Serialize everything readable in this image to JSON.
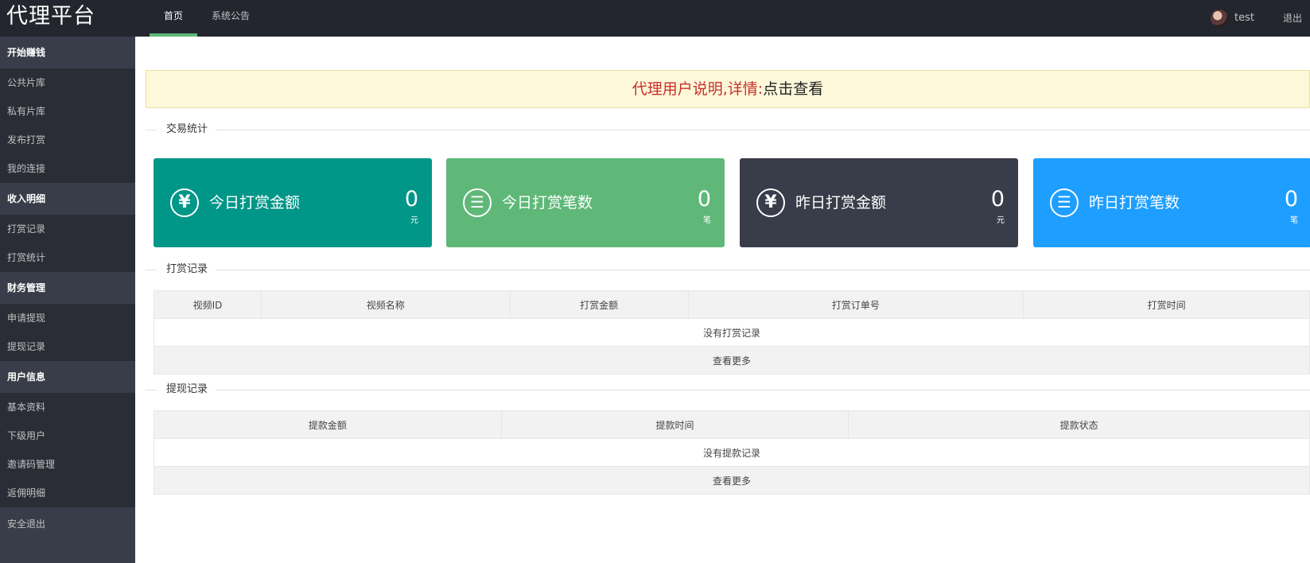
{
  "header": {
    "logo": "代理平台",
    "nav": [
      {
        "label": "首页",
        "active": true
      },
      {
        "label": "系统公告",
        "active": false
      }
    ],
    "user": "test",
    "logout": "退出"
  },
  "sidebar": {
    "groups": [
      {
        "title": "开始赚钱",
        "items": [
          "公共片库",
          "私有片库",
          "发布打赏",
          "我的连接"
        ]
      },
      {
        "title": "收入明细",
        "items": [
          "打赏记录",
          "打赏统计"
        ]
      },
      {
        "title": "财务管理",
        "items": [
          "申请提现",
          "提现记录"
        ]
      },
      {
        "title": "用户信息",
        "items": [
          "基本资料",
          "下级用户",
          "邀请码管理",
          "返佣明细"
        ]
      }
    ],
    "logout": "安全退出"
  },
  "notice": {
    "red_text": "代理用户说明,详情:",
    "link_text": "点击查看"
  },
  "sections": {
    "stats": "交易统计",
    "reward_records": "打赏记录",
    "withdraw_records": "提现记录"
  },
  "cards": [
    {
      "label": "今日打赏金额",
      "value": "0",
      "unit": "元",
      "icon": "yen-icon",
      "color": "#009688"
    },
    {
      "label": "今日打赏笔数",
      "value": "0",
      "unit": "笔",
      "icon": "list-icon",
      "color": "#5fb878"
    },
    {
      "label": "昨日打赏金额",
      "value": "0",
      "unit": "元",
      "icon": "yen-icon",
      "color": "#393d49"
    },
    {
      "label": "昨日打赏笔数",
      "value": "0",
      "unit": "笔",
      "icon": "list-icon",
      "color": "#1e9fff"
    }
  ],
  "reward_table": {
    "columns": [
      "视频ID",
      "视频名称",
      "打赏金额",
      "打赏订单号",
      "打赏时间"
    ],
    "empty": "没有打赏记录",
    "more": "查看更多"
  },
  "withdraw_table": {
    "columns": [
      "提款金额",
      "提款时间",
      "提款状态"
    ],
    "empty": "没有提款记录",
    "more": "查看更多"
  }
}
